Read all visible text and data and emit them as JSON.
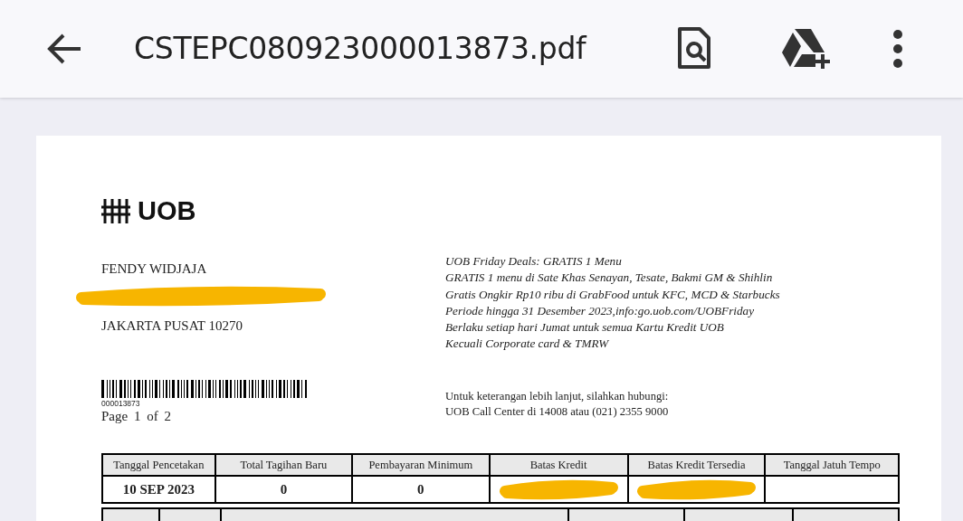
{
  "app_bar": {
    "title": "CSTEPC080923000013873.pdf"
  },
  "statement": {
    "logo_text": "UOB",
    "address": [
      {
        "kind": "text",
        "text": "FENDY WIDJAJA"
      },
      {
        "kind": "redacted"
      },
      {
        "kind": "text",
        "text": "JAKARTA PUSAT 10270"
      }
    ],
    "barcode_number": "000013873",
    "page_label": "Page 1 of 2",
    "promo_lines": [
      "UOB Friday Deals: GRATIS 1 Menu",
      "GRATIS 1 menu di Sate Khas Senayan, Tesate, Bakmi GM & Shihlin",
      "Gratis Ongkir Rp10 ribu di GrabFood untuk KFC, MCD & Starbucks",
      "Periode hingga 31 Desember 2023,info:go.uob.com/UOBFriday",
      "Berlaku setiap hari Jumat untuk semua Kartu Kredit UOB",
      "Kecuali Corporate card & TMRW"
    ],
    "contact_lines": [
      "Untuk keterangan lebih lanjut, silahkan hubungi:",
      "UOB Call Center di 14008 atau (021) 2355 9000"
    ],
    "summary_table": {
      "columns": [
        "Tanggal Pencetakan",
        "Total Tagihan Baru",
        "Pembayaran Minimum",
        "Batas Kredit",
        "Batas Kredit Tersedia",
        "Tanggal Jatuh Tempo"
      ],
      "values": [
        {
          "kind": "text",
          "text": "10 SEP 2023"
        },
        {
          "kind": "text",
          "text": "0"
        },
        {
          "kind": "text",
          "text": "0"
        },
        {
          "kind": "redacted"
        },
        {
          "kind": "redacted"
        },
        {
          "kind": "empty"
        }
      ]
    }
  }
}
